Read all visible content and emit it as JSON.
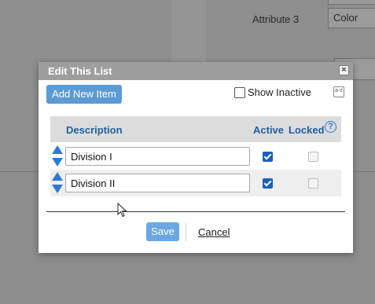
{
  "background": {
    "attribute_label": "Attribute 3",
    "attribute_value": "Color"
  },
  "dialog": {
    "title": "Edit This List",
    "close_symbol": "×",
    "add_button": "Add New Item",
    "show_inactive_label": "Show Inactive",
    "sort_icon_text": "a-z",
    "columns": {
      "description": "Description",
      "active": "Active",
      "locked": "Locked"
    },
    "help_symbol": "?",
    "rows": [
      {
        "description": "Division I",
        "active": true,
        "locked": false
      },
      {
        "description": "Division II",
        "active": true,
        "locked": false
      }
    ],
    "save_label": "Save",
    "cancel_label": "Cancel"
  },
  "colors": {
    "accent": "#5b9bd5",
    "header_text": "#1f5f9f",
    "overlay": "#8c8c8c"
  }
}
